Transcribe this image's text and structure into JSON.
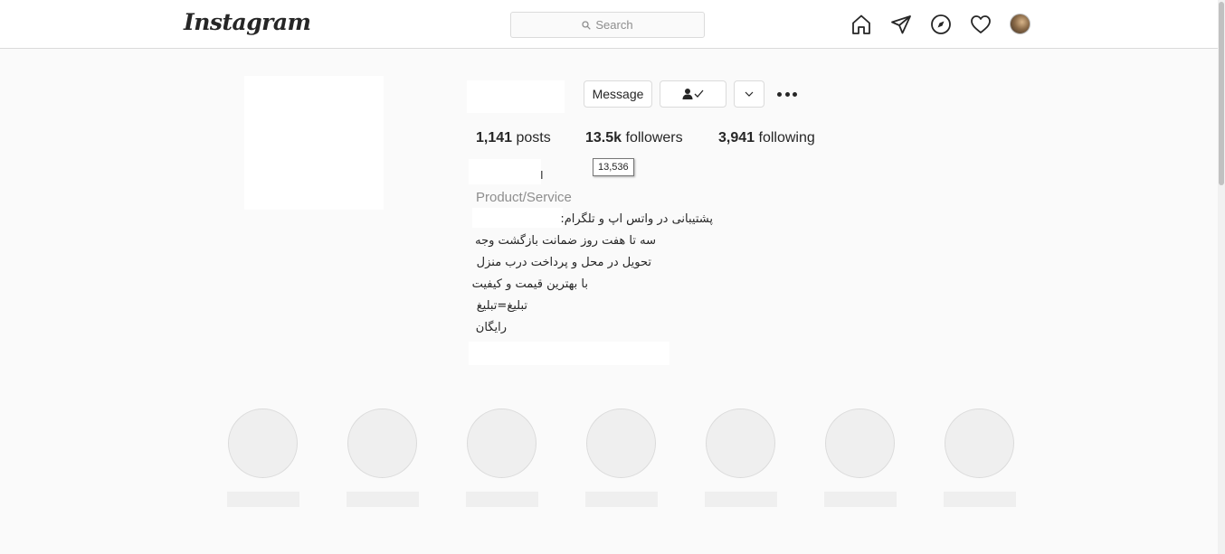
{
  "topbar": {
    "logo": "Instagram",
    "search_placeholder": "Search",
    "icons": [
      "home-icon",
      "direct-icon",
      "explore-icon",
      "activity-heart-icon",
      "profile-avatar"
    ]
  },
  "profile": {
    "buttons": {
      "message": "Message",
      "following_icon": "person-check-icon",
      "suggested_icon": "chevron-down-icon",
      "options_icon": "more-options-icon"
    },
    "stats": {
      "posts_count": "1,141",
      "posts_label": "posts",
      "followers_count": "13.5k",
      "followers_label": "followers",
      "following_count": "3,941",
      "following_label": "following"
    },
    "followers_tooltip": "13,536",
    "category": "Product/Service",
    "bio": {
      "line1": "پشتیبانی در واتس اپ و تلگرام:",
      "line2": "سه تا هفت روز ضمانت بازگشت وجه",
      "line3": "تحویل در محل و پرداخت درب منزل",
      "line4": "با بهترین قیمت و کیفیت",
      "line5": "تبلیغ=تبلیغ",
      "line6": "رایگان"
    }
  },
  "colors": {
    "background": "#fafafa",
    "border": "#dbdbdb",
    "text": "#262626",
    "muted": "#8e8e8e",
    "placeholder": "#efefef"
  }
}
